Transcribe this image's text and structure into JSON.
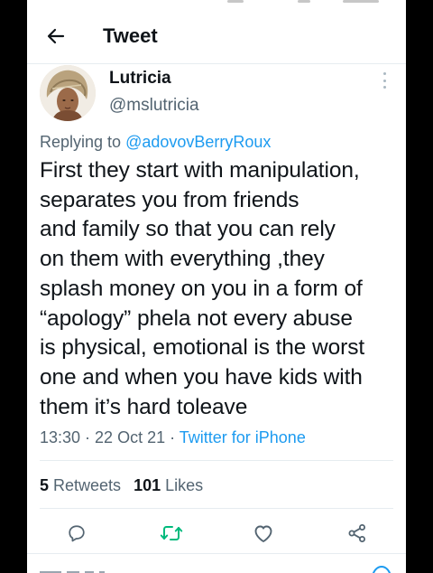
{
  "header": {
    "title": "Tweet",
    "back_icon": "arrow-left-icon"
  },
  "author": {
    "display_name": "Lutricia",
    "handle": "@mslutricia",
    "avatar_icon": "profile-photo"
  },
  "reply": {
    "prefix": "Replying to ",
    "mention": "@adovovBerryRoux"
  },
  "tweet": {
    "text": "First they start with manipulation,\nseparates you from friends\nand family so that you can rely\non them with everything ,they\nsplash money on you in a form of\n“apology” phela not every abuse\nis physical, emotional is the worst\none and when you have kids with\nthem it’s hard toleave"
  },
  "meta": {
    "time": "13:30",
    "separator": " · ",
    "date": "22 Oct 21",
    "source": "Twitter for iPhone"
  },
  "stats": {
    "retweets_count": "5",
    "retweets_label": " Retweets",
    "likes_count": "101",
    "likes_label": " Likes"
  },
  "actions": [
    "reply-icon",
    "retweet-icon",
    "like-icon",
    "share-icon"
  ],
  "colors": {
    "accent": "#1d9bf0",
    "retweet": "#00ba7c",
    "text": "#0f1419",
    "secondary": "#536471",
    "divider": "#e6ecf0"
  }
}
